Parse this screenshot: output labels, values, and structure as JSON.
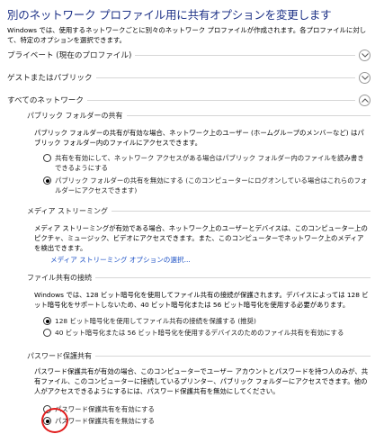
{
  "title": "別のネットワーク プロファイル用に共有オプションを変更します",
  "intro": "Windows では、使用するネットワークごとに別々のネットワーク プロファイルが作成されます。各プロファイルに対して、特定のオプションを選択できます。",
  "sections": {
    "private": "プライベート (現在のプロファイル)",
    "guest": "ゲストまたはパブリック",
    "all": "すべてのネットワーク"
  },
  "public_folder": {
    "heading": "パブリック フォルダーの共有",
    "desc": "パブリック フォルダーの共有が有効な場合、ネットワーク上のユーザー (ホームグループのメンバーなど) はパブリック フォルダー内のファイルにアクセスできます。",
    "opt_on": "共有を有効にして、ネットワーク アクセスがある場合はパブリック フォルダー内のファイルを読み書きできるようにする",
    "opt_off": "パブリック フォルダーの共有を無効にする (このコンピューターにログオンしている場合はこれらのフォルダーにアクセスできます)"
  },
  "media": {
    "heading": "メディア ストリーミング",
    "desc": "メディア ストリーミングが有効である場合、ネットワーク上のユーザーとデバイスは、このコンピューター上のピクチャ、ミュージック、ビデオにアクセスできます。また、このコンピューターでネットワーク上のメディアを検出できます。",
    "link": "メディア ストリーミング オプションの選択..."
  },
  "file_sharing": {
    "heading": "ファイル共有の接続",
    "desc": "Windows では、128 ビット暗号化を使用してファイル共有の接続が保護されます。デバイスによっては 128 ビット暗号化をサポートしないため、40 ビット暗号化または 56 ビット暗号化を使用する必要があります。",
    "opt_128": "128 ビット暗号化を使用してファイル共有の接続を保護する (推奨)",
    "opt_40": "40 ビット暗号化または 56 ビット暗号化を使用するデバイスのためのファイル共有を有効にする"
  },
  "password": {
    "heading": "パスワード保護共有",
    "desc": "パスワード保護共有が有効の場合、このコンピューターでユーザー アカウントとパスワードを持つ人のみが、共有ファイル、このコンピューターに接続しているプリンター、パブリック フォルダーにアクセスできます。他の人がアクセスできるようにするには、パスワード保護共有を無効にしてください。",
    "opt_on": "パスワード保護共有を有効にする",
    "opt_off": "パスワード保護共有を無効にする"
  },
  "icons": {
    "collapsed": "chevron-down-icon",
    "expanded": "chevron-up-icon",
    "highlight_color": "#e11b1b",
    "link_color": "#1e52c6",
    "title_color": "#1e3287"
  }
}
